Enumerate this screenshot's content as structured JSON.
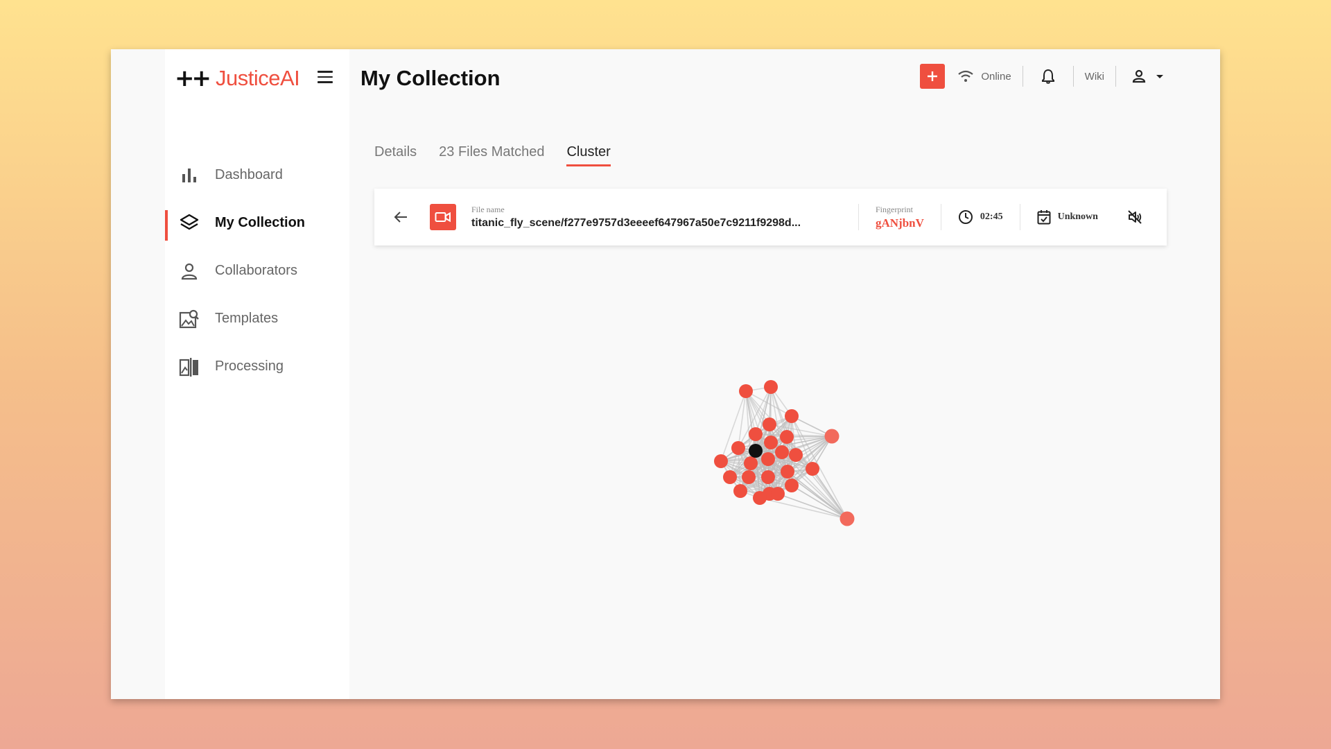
{
  "app": {
    "logo_plus": "++",
    "logo_text": "JusticeAI"
  },
  "page": {
    "title": "My Collection"
  },
  "topbar": {
    "status": "Online",
    "wiki": "Wiki"
  },
  "sidebar": {
    "items": [
      {
        "label": "Dashboard",
        "icon": "bar-chart-icon",
        "active": false
      },
      {
        "label": "My Collection",
        "icon": "layers-icon",
        "active": true
      },
      {
        "label": "Collaborators",
        "icon": "person-icon",
        "active": false
      },
      {
        "label": "Templates",
        "icon": "template-search-icon",
        "active": false
      },
      {
        "label": "Processing",
        "icon": "compare-icon",
        "active": false
      }
    ]
  },
  "tabs": [
    {
      "label": "Details",
      "active": false
    },
    {
      "label": "23 Files Matched",
      "active": false
    },
    {
      "label": "Cluster",
      "active": true
    }
  ],
  "file": {
    "name_label": "File name",
    "name": "titanic_fly_scene/f277e9757d3eeeef647967a50e7c9211f9298d...",
    "fingerprint_label": "Fingerprint",
    "fingerprint": "gANjbnV",
    "duration": "02:45",
    "date": "Unknown"
  },
  "colors": {
    "accent": "#ef4f3f",
    "center_node": "#111111",
    "edge": "#bdbdbd"
  }
}
